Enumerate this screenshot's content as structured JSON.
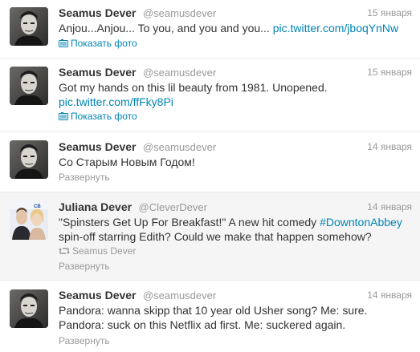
{
  "tweets": [
    {
      "name": "Seamus Dever",
      "handle": "@seamusdever",
      "date": "15 января",
      "text": "Anjou...Anjou... To you, and you and you... ",
      "link": "pic.twitter.com/jboqYnNw",
      "action": "Показать фото"
    },
    {
      "name": "Seamus Dever",
      "handle": "@seamusdever",
      "date": "15 января",
      "text": "Got my hands on this lil beauty from 1981. Unopened.",
      "link": "pic.twitter.com/ffFky8Pi",
      "action": "Показать фото"
    },
    {
      "name": "Seamus Dever",
      "handle": "@seamusdever",
      "date": "14 января",
      "text": "Со Старым Новым Годом!",
      "action": "Развернуть"
    },
    {
      "name": "Juliana Dever",
      "handle": "@CleverDever",
      "date": "14 января",
      "text_before": "\"Spinsters Get Up For Breakfast!\" A new hit comedy ",
      "hashtag": "#DowntonAbbey",
      "text_after": "spin-off starring Edith? Could we make that happen somehow?",
      "retweeted_by": "Seamus Dever",
      "action": "Развернуть"
    },
    {
      "name": "Seamus Dever",
      "handle": "@seamusdever",
      "date": "14 января",
      "line1": "Pandora: wanna skipp that 10 year old Usher song? Me: sure.",
      "line2": "Pandora: suck on this Netflix ad first. Me: suckered again.",
      "action": "Развернуть"
    }
  ],
  "colors": {
    "link": "#0084b4",
    "muted": "#999999",
    "text": "#333333"
  },
  "icons": {
    "photo": "photo-icon",
    "retweet": "retweet-icon"
  }
}
